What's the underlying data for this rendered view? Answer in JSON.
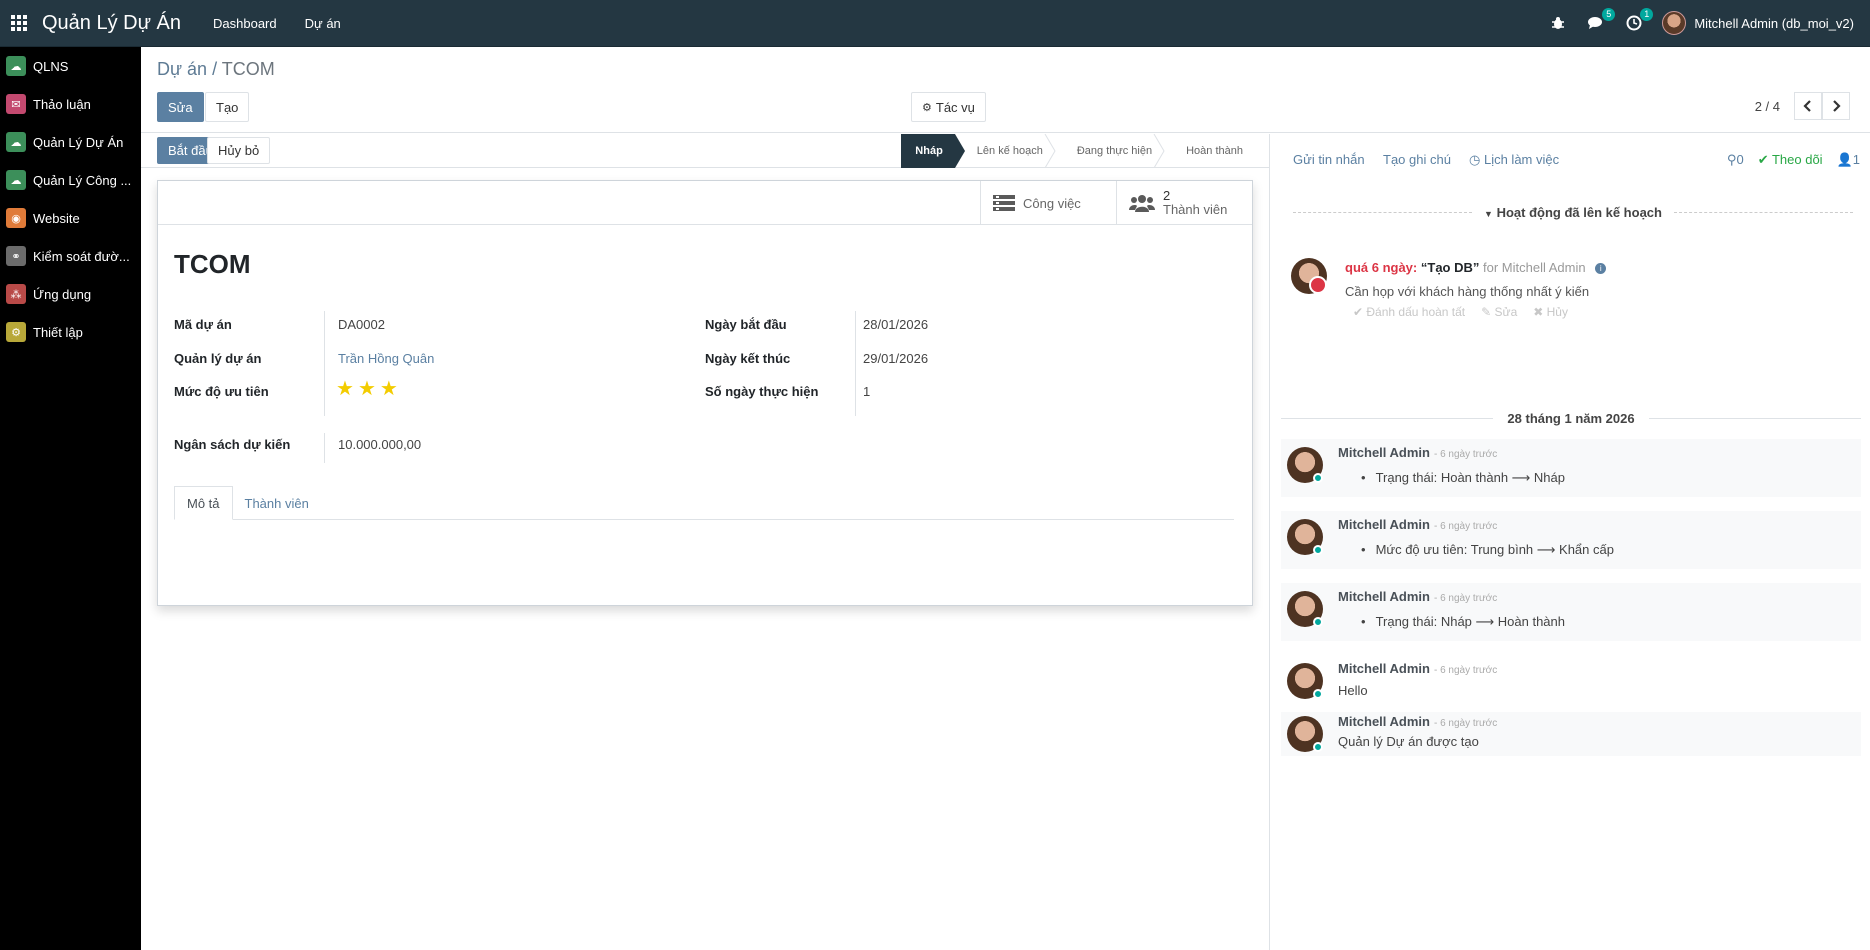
{
  "topbar": {
    "brand": "Quản Lý Dự Án",
    "nav": [
      "Dashboard",
      "Dự án"
    ],
    "messages_badge": "5",
    "activity_badge": "1",
    "user": "Mitchell Admin (db_moi_v2)"
  },
  "sidebar": {
    "items": [
      {
        "label": "QLNS",
        "icon": "cloud-icon",
        "color": "#3c8f5a"
      },
      {
        "label": "Thảo luận",
        "icon": "chat-icon",
        "color": "#c3496f"
      },
      {
        "label": "Quản Lý Dự Án",
        "icon": "cloud-icon",
        "color": "#3c8f5a"
      },
      {
        "label": "Quản Lý Công ...",
        "icon": "cloud-icon",
        "color": "#3c8f5a"
      },
      {
        "label": "Website",
        "icon": "globe-icon",
        "color": "#e07b39"
      },
      {
        "label": "Kiểm soát đườ...",
        "icon": "link-icon",
        "color": "#6b6b6b"
      },
      {
        "label": "Ứng dụng",
        "icon": "apps-icon",
        "color": "#b94a48"
      },
      {
        "label": "Thiết lập",
        "icon": "gear-icon",
        "color": "#b8a839"
      }
    ]
  },
  "control": {
    "breadcrumb_parent": "Dự án",
    "breadcrumb_sep": "/",
    "breadcrumb_current": "TCOM",
    "edit_label": "Sửa",
    "create_label": "Tạo",
    "action_label": "Tác vụ",
    "pager": "2 / 4"
  },
  "statusbar": {
    "start_label": "Bắt đầu",
    "cancel_label": "Hủy bỏ",
    "stages": [
      "Nháp",
      "Lên kế hoạch",
      "Đang thực hiện",
      "Hoàn thành"
    ]
  },
  "sheet": {
    "tasks_label": "Công việc",
    "members_count": "2",
    "members_label": "Thành viên",
    "name": "TCOM",
    "fields": {
      "code_label": "Mã dự án",
      "code_value": "DA0002",
      "manager_label": "Quản lý dự án",
      "manager_value": "Trần Hồng Quân",
      "priority_label": "Mức độ ưu tiên",
      "priority_stars": 3,
      "start_label": "Ngày bắt đầu",
      "start_value": "28/01/2026",
      "end_label": "Ngày kết thúc",
      "end_value": "29/01/2026",
      "days_label": "Số ngày thực hiện",
      "days_value": "1",
      "budget_label": "Ngân sách dự kiến",
      "budget_value": "10.000.000,00"
    },
    "tabs": [
      "Mô tả",
      "Thành viên"
    ]
  },
  "chatter": {
    "send_message": "Gửi tin nhắn",
    "log_note": "Tạo ghi chú",
    "schedule": "Lịch làm việc",
    "attachments": "0",
    "follow": "Theo dõi",
    "followers": "1",
    "planned_title": "Hoạt động đã lên kế hoạch",
    "activity": {
      "overdue": "quá 6 ngày:",
      "title": "“Tạo DB”",
      "for": "for Mitchell Admin",
      "note": "Cần họp với khách hàng thống nhất ý kiến",
      "mark_done": "Đánh dấu hoàn tất",
      "edit": "Sửa",
      "cancel": "Hủy"
    },
    "date_separator": "28 tháng 1 năm 2026",
    "messages": [
      {
        "author": "Mitchell Admin",
        "time": "- 6 ngày trước",
        "tracking": "Trạng thái: Hoàn thành ⟶ Nháp"
      },
      {
        "author": "Mitchell Admin",
        "time": "- 6 ngày trước",
        "tracking": "Mức độ ưu tiên: Trung bình ⟶ Khẩn cấp"
      },
      {
        "author": "Mitchell Admin",
        "time": "- 6 ngày trước",
        "tracking": "Trạng thái: Nháp ⟶ Hoàn thành"
      },
      {
        "author": "Mitchell Admin",
        "time": "- 6 ngày trước",
        "body": "Hello"
      },
      {
        "author": "Mitchell Admin",
        "time": "- 6 ngày trước",
        "body": "Quản lý Dự án được tạo"
      }
    ]
  }
}
